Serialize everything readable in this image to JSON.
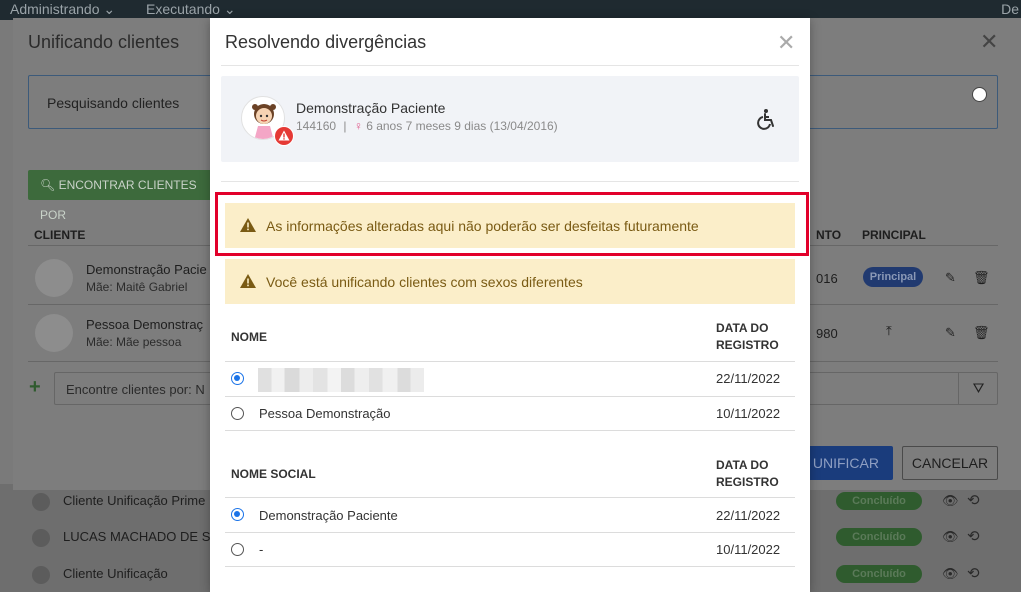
{
  "navbar": {
    "items": [
      "Administrando ⌄",
      "Executando ⌄"
    ],
    "right_text": "De"
  },
  "background_list": {
    "rows": [
      {
        "name": "Cliente Unificação Prime",
        "status": "Concluído"
      },
      {
        "name": "LUCAS MACHADO DE SO",
        "status": "Concluído"
      },
      {
        "name": "Cliente Unificação",
        "status": "Concluído"
      }
    ]
  },
  "modal_unify": {
    "title": "Unificando clientes",
    "search_label": "Pesquisando clientes",
    "find_button": "ENCONTRAR CLIENTES POR",
    "columns": {
      "cliente": "CLIENTE",
      "nascimento": "NTO",
      "principal": "PRINCIPAL"
    },
    "rows": [
      {
        "name": "Demonstração Pacie",
        "mae": "Mãe: Maitê Gabriel",
        "num": "016",
        "principal": "Principal"
      },
      {
        "name": "Pessoa Demonstraç",
        "mae": "Mãe: Mãe pessoa",
        "num": "980",
        "principal": ""
      }
    ],
    "find_placeholder": "Encontre clientes por: N",
    "unify_button": "E UNIFICAR",
    "cancel_button": "CANCELAR"
  },
  "modal_resolve": {
    "title": "Resolvendo divergências",
    "patient": {
      "name": "Demonstração Paciente",
      "id": "144160",
      "separator": "|",
      "sex_icon": "♀",
      "age": "6 anos 7 meses 9 dias (13/04/2016)"
    },
    "alerts": [
      "As informações alteradas aqui não poderão ser desfeitas futuramente",
      "Você está unificando clientes com sexos diferentes"
    ],
    "name_table": {
      "col_name": "NOME",
      "col_date_1": "DATA DO",
      "col_date_2": "REGISTRO",
      "rows": [
        {
          "name": "",
          "date": "22/11/2022",
          "selected": true
        },
        {
          "name": "Pessoa Demonstração",
          "date": "10/11/2022",
          "selected": false
        }
      ]
    },
    "social_table": {
      "col_name": "NOME SOCIAL",
      "col_date_1": "DATA DO",
      "col_date_2": "REGISTRO",
      "rows": [
        {
          "name": "Demonstração Paciente",
          "date": "22/11/2022",
          "selected": true
        },
        {
          "name": "-",
          "date": "10/11/2022",
          "selected": false
        }
      ]
    }
  },
  "colors": {
    "alert_bg": "#fbeec9",
    "alert_text": "#7a5b14",
    "highlight": "#e2002a",
    "radio_checked": "#1a73e8"
  }
}
